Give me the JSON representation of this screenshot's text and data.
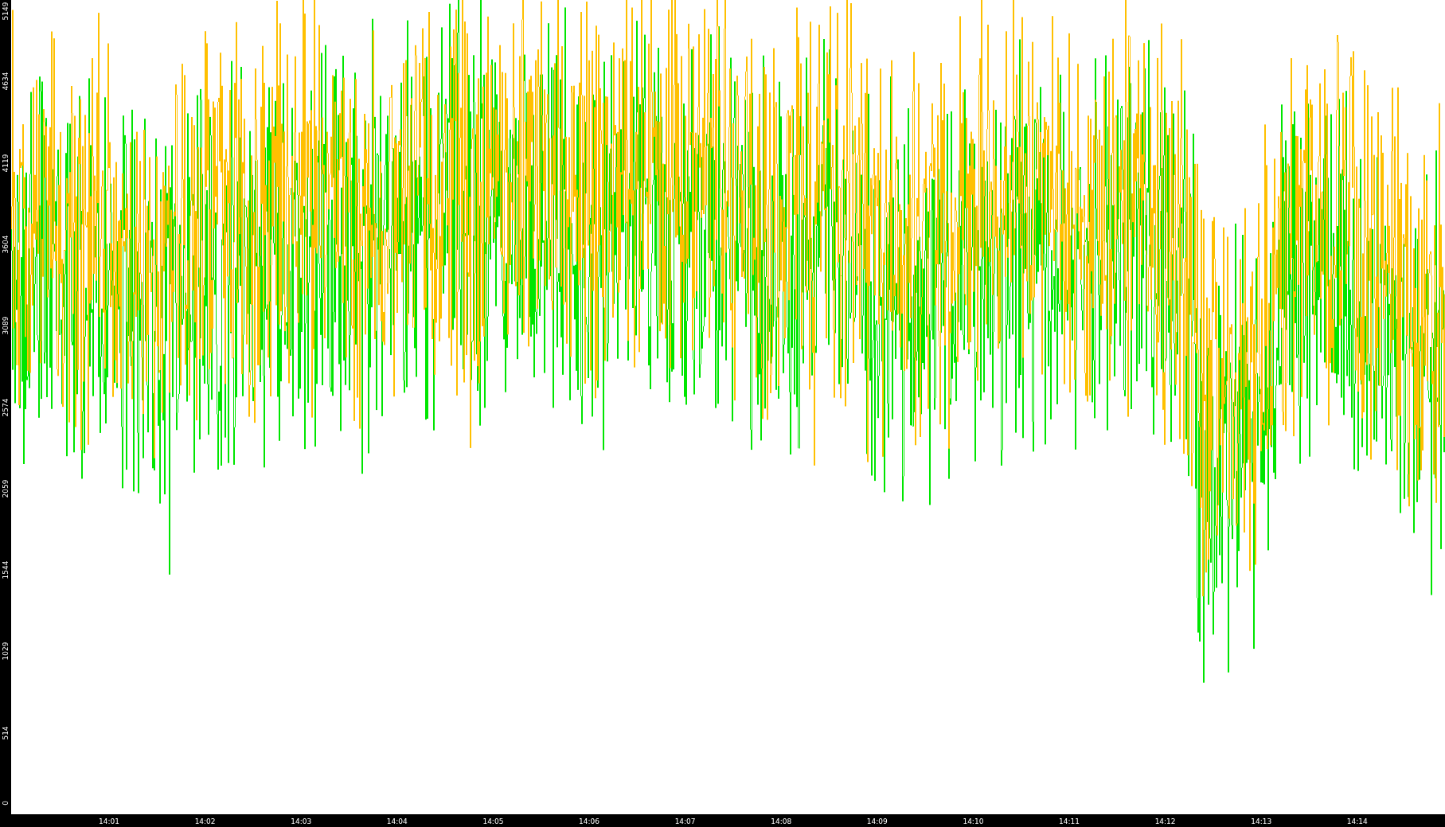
{
  "y_axis": {
    "labels": [
      "5149",
      "4634",
      "4119",
      "3604",
      "3089",
      "2574",
      "2059",
      "1544",
      "1029",
      "514",
      "0"
    ]
  },
  "x_axis": {
    "labels": [
      "14:01",
      "14:02",
      "14:03",
      "14:04",
      "14:05",
      "14:06",
      "14:07",
      "14:08",
      "14:09",
      "14:10",
      "14:11",
      "14:12",
      "14:13",
      "14:14"
    ]
  }
}
